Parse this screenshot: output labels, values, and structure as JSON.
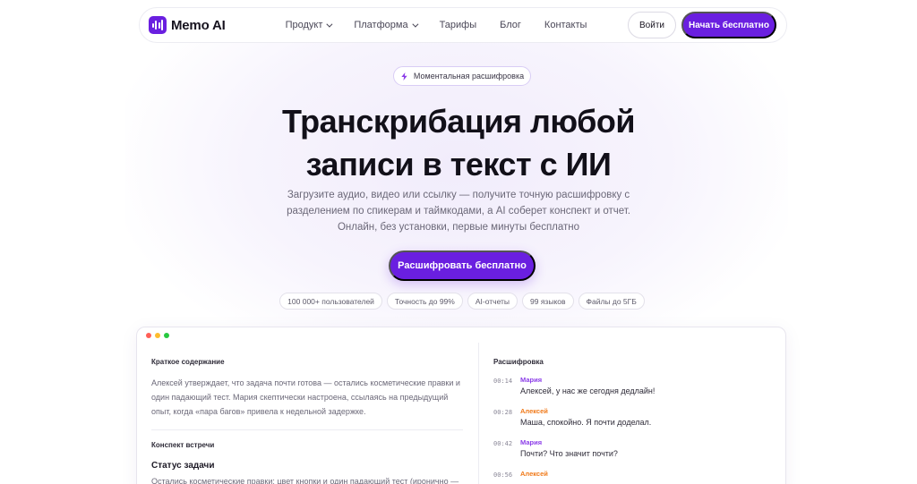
{
  "brand": {
    "name": "Memo AI",
    "accent": "#6a1fe0"
  },
  "nav": {
    "items": [
      {
        "label": "Продукт",
        "dropdown": true
      },
      {
        "label": "Платформа",
        "dropdown": true
      },
      {
        "label": "Тарифы",
        "dropdown": false
      },
      {
        "label": "Блог",
        "dropdown": false
      },
      {
        "label": "Контакты",
        "dropdown": false
      }
    ],
    "login_label": "Войти",
    "start_label": "Начать бесплатно"
  },
  "hero": {
    "badge": "Моментальная расшифровка",
    "title_line1": "Транскрибация любой",
    "title_line2": "записи в текст с ИИ",
    "subtitle_line1": "Загрузите аудио, видео или ссылку — получите точную расшифровку с",
    "subtitle_line2": "разделением по спикерам и таймкодами, а AI соберет конспект и отчет.",
    "subtitle_line3": "Онлайн, без установки, первые минуты бесплатно",
    "cta": "Расшифровать бесплатно",
    "chips": [
      "100 000+ пользователей",
      "Точность до 99%",
      "AI-отчеты",
      "99 языков",
      "Файлы до 5ГБ"
    ]
  },
  "preview": {
    "window_dots": [
      "#ff5f57",
      "#febc2e",
      "#28c840"
    ],
    "summary_title": "Краткое содержание",
    "summary_text": "Алексей утверждает, что задача почти готова — остались косметические правки и один падающий тест. Мария скептически настроена, ссылаясь на предыдущий опыт, когда «пара багов» привела к недельной задержке.",
    "notes_title": "Конспект встречи",
    "status_title": "Статус задачи",
    "status_text": "Остались косметические правки: цвет кнопки и один падающий тест (иронично — тест на проверку дедлайнов). Архитектурных проблем нет — подтверждено",
    "transcript_title": "Расшифровка",
    "messages": [
      {
        "time": "00:14",
        "speaker": "Мария",
        "color": "#8b3ce8",
        "text": "Алексей, у нас же сегодня дедлайн!"
      },
      {
        "time": "00:28",
        "speaker": "Алексей",
        "color": "#f07a1a",
        "text": "Маша, спокойно. Я почти доделал."
      },
      {
        "time": "00:42",
        "speaker": "Мария",
        "color": "#8b3ce8",
        "text": "Почти? Что значит почти?"
      },
      {
        "time": "00:56",
        "speaker": "Алексей",
        "color": "#f07a1a",
        "text": ""
      }
    ]
  }
}
